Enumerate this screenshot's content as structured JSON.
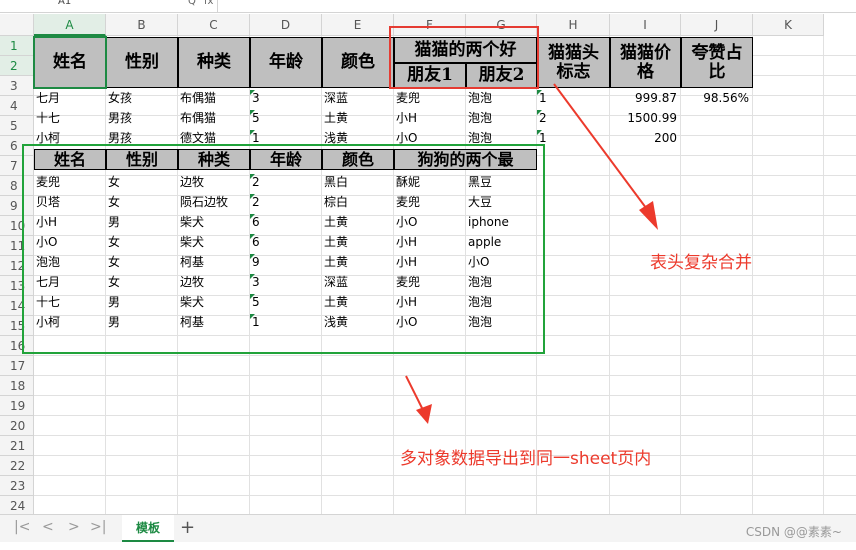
{
  "formula_bar": {
    "name_box": "A1",
    "fx_label": "fx",
    "search_glyph": "Q"
  },
  "columns": [
    "A",
    "B",
    "C",
    "D",
    "E",
    "F",
    "G",
    "H",
    "I",
    "J",
    "K"
  ],
  "rows": [
    "1",
    "2",
    "3",
    "4",
    "5",
    "6",
    "7",
    "8",
    "9",
    "10",
    "11",
    "12",
    "13",
    "14",
    "15",
    "16",
    "17",
    "18",
    "19",
    "20",
    "21",
    "22",
    "23",
    "24"
  ],
  "cat_table": {
    "headers": {
      "name": "姓名",
      "gender": "性别",
      "kind": "种类",
      "age": "年龄",
      "color": "颜色",
      "friends_group": "猫猫的两个好",
      "friend1": "朋友1",
      "friend2": "朋友2",
      "flag": "猫猫头标志",
      "price": "猫猫价格",
      "ratio": "夸赞占比"
    },
    "rows": [
      {
        "name": "七月",
        "gender": "女孩",
        "kind": "布偶猫",
        "age": "3",
        "color": "深蓝",
        "f1": "麦兜",
        "f2": "泡泡",
        "flag": "1",
        "price": "999.87",
        "ratio": "98.56%"
      },
      {
        "name": "十七",
        "gender": "男孩",
        "kind": "布偶猫",
        "age": "5",
        "color": "土黄",
        "f1": "小H",
        "f2": "泡泡",
        "flag": "2",
        "price": "1500.99",
        "ratio": ""
      },
      {
        "name": "小柯",
        "gender": "男孩",
        "kind": "德文猫",
        "age": "1",
        "color": "浅黄",
        "f1": "小O",
        "f2": "泡泡",
        "flag": "1",
        "price": "200",
        "ratio": ""
      }
    ]
  },
  "dog_table": {
    "headers": {
      "name": "姓名",
      "gender": "性别",
      "kind": "种类",
      "age": "年龄",
      "color": "颜色",
      "best_two": "狗狗的两个最"
    },
    "rows": [
      {
        "name": "麦兜",
        "gender": "女",
        "kind": "边牧",
        "age": "2",
        "color": "黑白",
        "a": "酥妮",
        "b": "黑豆"
      },
      {
        "name": "贝塔",
        "gender": "女",
        "kind": "陨石边牧",
        "age": "2",
        "color": "棕白",
        "a": "麦兜",
        "b": "大豆"
      },
      {
        "name": "小H",
        "gender": "男",
        "kind": "柴犬",
        "age": "6",
        "color": "土黄",
        "a": "小O",
        "b": "iphone"
      },
      {
        "name": "小O",
        "gender": "女",
        "kind": "柴犬",
        "age": "6",
        "color": "土黄",
        "a": "小H",
        "b": "apple"
      },
      {
        "name": "泡泡",
        "gender": "女",
        "kind": "柯基",
        "age": "9",
        "color": "土黄",
        "a": "小H",
        "b": "小O"
      },
      {
        "name": "七月",
        "gender": "女",
        "kind": "边牧",
        "age": "3",
        "color": "深蓝",
        "a": "麦兜",
        "b": "泡泡"
      },
      {
        "name": "十七",
        "gender": "男",
        "kind": "柴犬",
        "age": "5",
        "color": "土黄",
        "a": "小H",
        "b": "泡泡"
      },
      {
        "name": "小柯",
        "gender": "男",
        "kind": "柯基",
        "age": "1",
        "color": "浅黄",
        "a": "小O",
        "b": "泡泡"
      }
    ]
  },
  "annotations": {
    "header_merge": "表头复杂合并",
    "multi_object": "多对象数据导出到同一sheet页内"
  },
  "sheet_tabs": {
    "active": "模板",
    "add": "+"
  },
  "watermark": "CSDN @@素素~",
  "colors": {
    "accent_green": "#1d8a43",
    "box_green": "#21a33a",
    "annotation_red": "#e53b32",
    "header_gray": "#bfbfbf"
  }
}
